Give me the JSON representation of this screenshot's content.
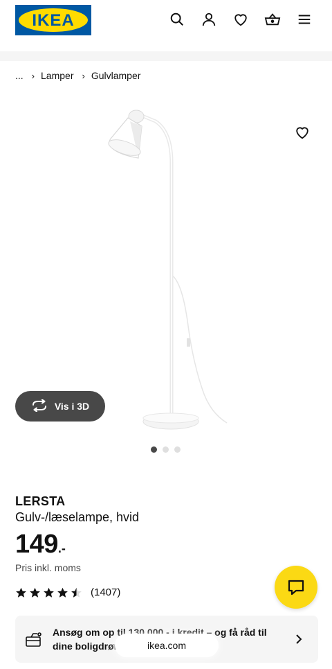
{
  "header": {
    "logo_text": "IKEA",
    "icons": [
      "search-icon",
      "account-icon",
      "heart-icon",
      "basket-icon",
      "menu-icon"
    ],
    "colors": {
      "logo_blue": "#0058a3",
      "logo_yellow": "#ffdb00"
    }
  },
  "breadcrumb": {
    "root": "...",
    "items": [
      "Lamper",
      "Gulvlamper"
    ]
  },
  "gallery": {
    "view_3d_label": "Vis i 3D",
    "image_count": 3,
    "active_image": 1
  },
  "product": {
    "name": "LERSTA",
    "description": "Gulv-/læselampe, hvid",
    "price": "149",
    "price_suffix": ".-",
    "vat_note": "Pris inkl. moms",
    "rating": 4.5,
    "rating_max": 5,
    "review_count": "(1407)"
  },
  "promo": {
    "text": "Ansøg om op til 130.000,- i kredit – og få råd til dine boligdrømme i dag"
  },
  "browser": {
    "url": "ikea.com"
  },
  "accent": {
    "chat_yellow": "#fbd914",
    "dark_button": "#484848"
  }
}
